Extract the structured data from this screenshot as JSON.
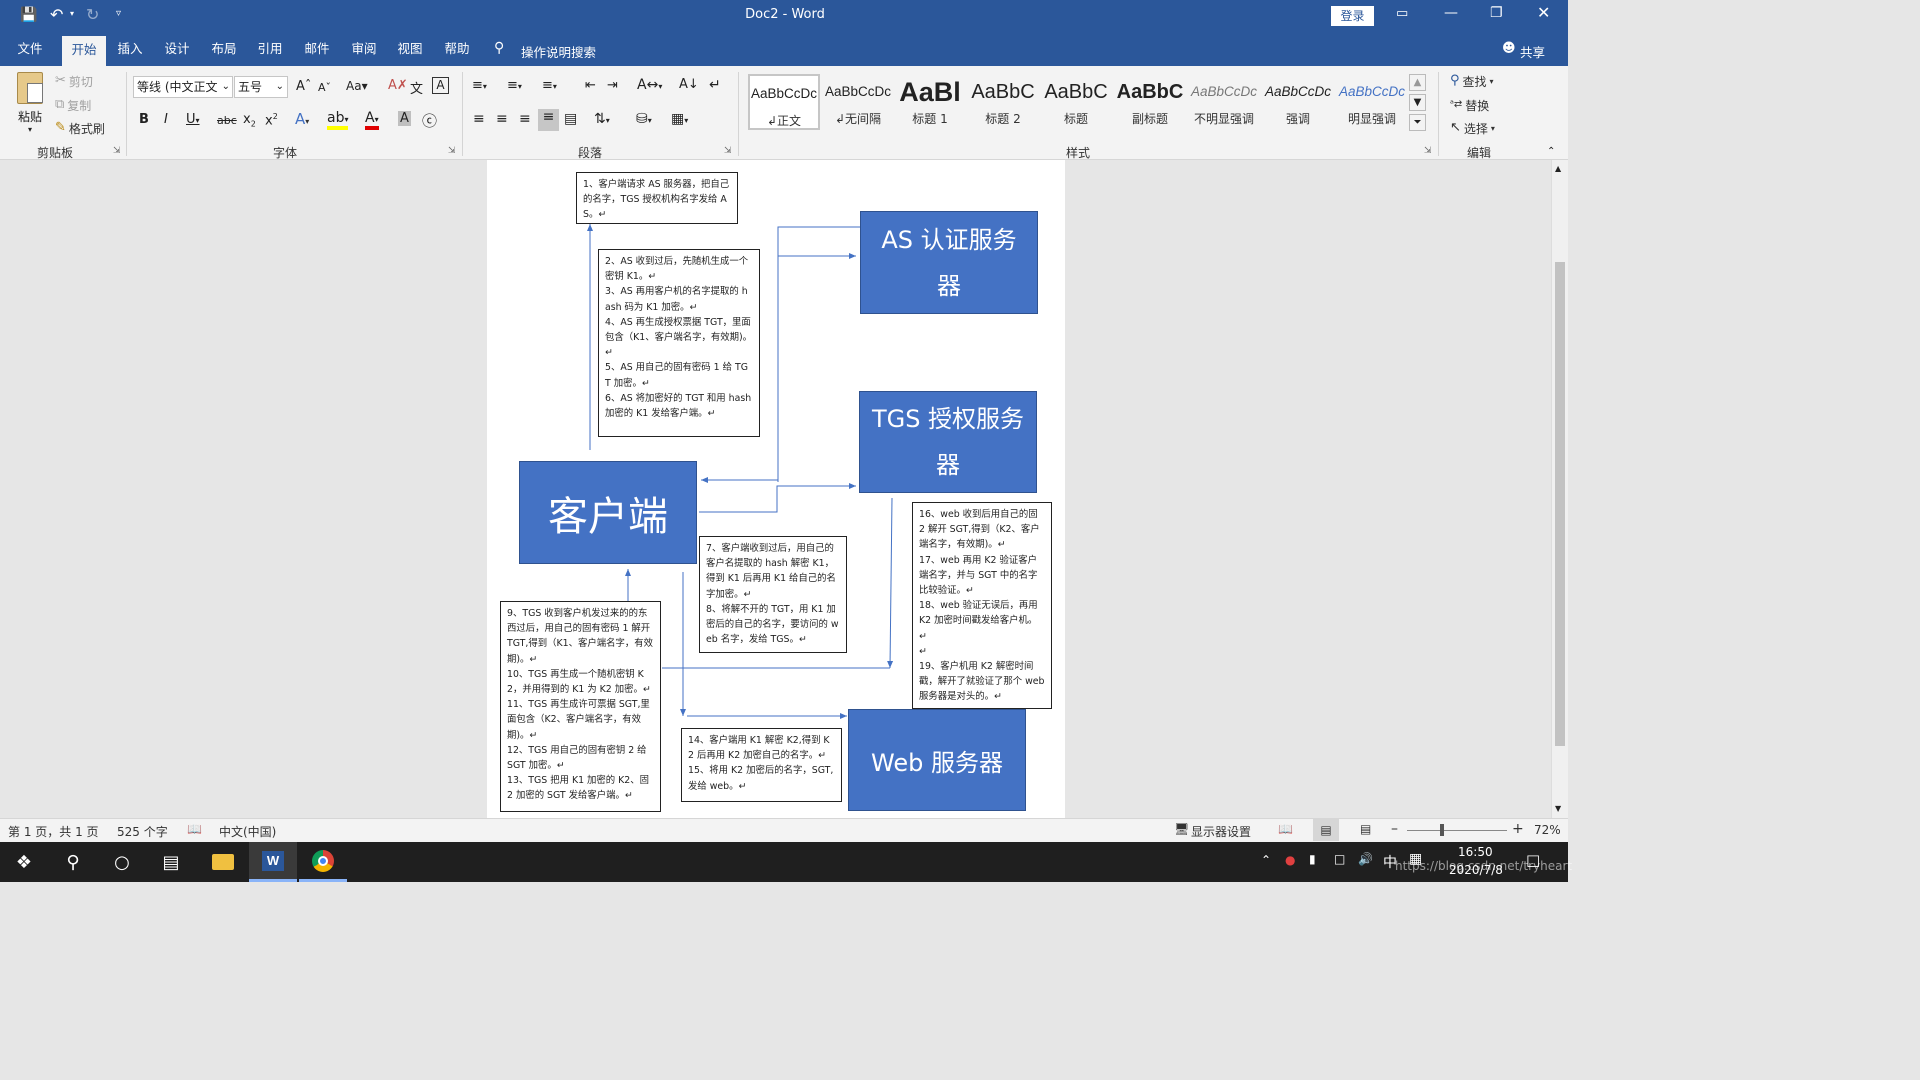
{
  "window": {
    "title": "Doc2 - Word",
    "login_label": "登录",
    "share_label": "共享"
  },
  "tabs": [
    "文件",
    "开始",
    "插入",
    "设计",
    "布局",
    "引用",
    "邮件",
    "审阅",
    "视图",
    "帮助"
  ],
  "active_tab": "开始",
  "tell_me": "操作说明搜索",
  "clipboard": {
    "paste": "粘贴",
    "cut": "剪切",
    "copy": "复制",
    "format_painter": "格式刷",
    "group": "剪贴板"
  },
  "font": {
    "font_name": "等线 (中文正文",
    "font_size": "五号",
    "group": "字体"
  },
  "paragraph": {
    "group": "段落"
  },
  "styles": {
    "group": "样式",
    "items": [
      {
        "preview": "AaBbCcDc",
        "name": "正文"
      },
      {
        "preview": "AaBbCcDc",
        "name": "无间隔"
      },
      {
        "preview": "AaBl",
        "name": "标题 1"
      },
      {
        "preview": "AaBbC",
        "name": "标题 2"
      },
      {
        "preview": "AaBbC",
        "name": "标题"
      },
      {
        "preview": "AaBbC",
        "name": "副标题"
      },
      {
        "preview": "AaBbCcDc",
        "name": "不明显强调"
      },
      {
        "preview": "AaBbCcDc",
        "name": "强调"
      },
      {
        "preview": "AaBbCcDc",
        "name": "明显强调"
      }
    ]
  },
  "editing": {
    "find": "查找",
    "replace": "替换",
    "select": "选择",
    "group": "编辑"
  },
  "diagram": {
    "as_server": "AS 认证服务器",
    "tgs_server": "TGS 授权服务器",
    "client": "客户端",
    "web_server": "Web 服务器",
    "note1": "1、客户端请求 AS 服务器，把自己的名字，TGS 授权机构名字发给 AS。↵",
    "note2": "2、AS 收到过后，先随机生成一个密钥 K1。↵\n3、AS 再用客户机的名字提取的 hash 码为 K1 加密。↵\n4、AS 再生成授权票据 TGT，里面包含（K1、客户端名字，有效期)。↵\n5、AS 用自己的固有密码 1 给 TGT 加密。↵\n6、AS 将加密好的 TGT 和用 hash 加密的 K1 发给客户端。↵",
    "note3": "7、客户端收到过后，用自己的客户名提取的 hash 解密 K1，得到 K1 后再用 K1 给自己的名字加密。↵\n8、将解不开的 TGT，用 K1 加密后的自己的名字，要访问的 web 名字，发给 TGS。↵",
    "note4": "9、TGS 收到客户机发过来的的东西过后，用自己的固有密码 1 解开 TGT,得到（K1、客户端名字，有效期)。↵\n10、TGS 再生成一个随机密钥 K2，并用得到的 K1 为 K2 加密。↵\n11、TGS 再生成许可票据 SGT,里面包含（K2、客户端名字，有效期)。↵\n12、TGS 用自己的固有密钥 2 给 SGT 加密。↵\n13、TGS 把用 K1 加密的 K2、固 2 加密的 SGT 发给客户端。↵",
    "note5": "14、客户端用 K1 解密 K2,得到 K2 后再用 K2 加密自己的名字。↵\n15、将用 K2 加密后的名字，SGT,发给 web。↵",
    "note6": "16、web 收到后用自己的固 2 解开 SGT,得到（K2、客户端名字，有效期)。↵\n17、web 再用 K2 验证客户端名字，并与 SGT 中的名字比较验证。↵\n18、web 验证无误后，再用 K2 加密时间戳发给客户机。↵\n↵\n19、客户机用 K2 解密时间戳，解开了就验证了那个 web 服务器是对头的。↵"
  },
  "status": {
    "page": "第 1 页，共 1 页",
    "words": "525 个字",
    "language": "中文(中国)",
    "display_settings": "显示器设置",
    "zoom": "72%"
  },
  "taskbar": {
    "time": "16:50",
    "date": "2020/7/8",
    "ime": "中",
    "watermark": "https://blog.csdn.net/tryheart"
  }
}
